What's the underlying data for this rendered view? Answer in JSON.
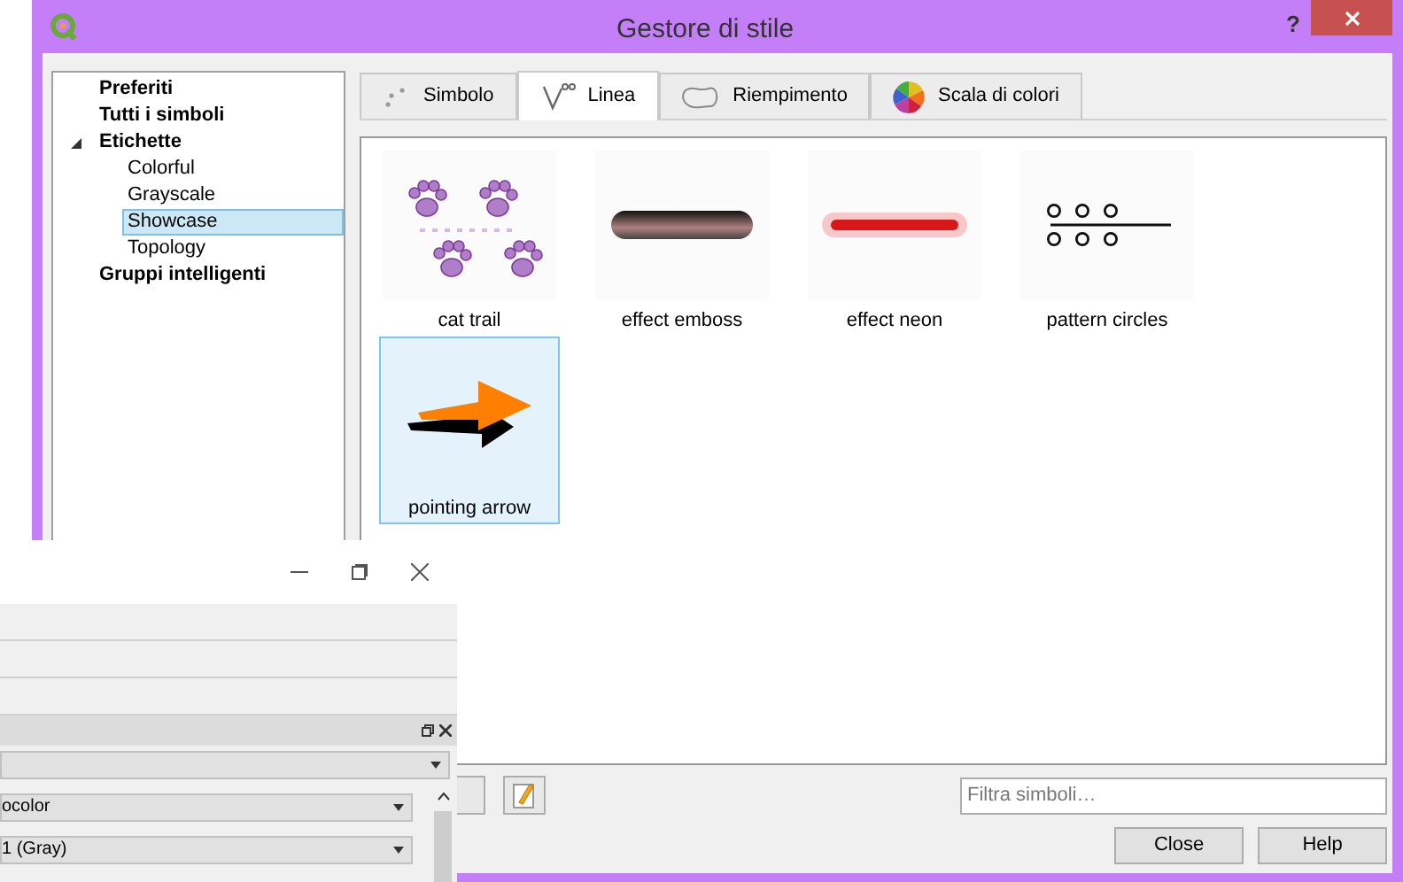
{
  "window": {
    "title": "Gestore di stile",
    "help": "?"
  },
  "tree": [
    {
      "label": "Preferiti",
      "selected": false
    },
    {
      "label": "Tutti i simboli",
      "selected": false
    },
    {
      "label": "Etichette",
      "selected": false,
      "expanded": true,
      "children": [
        {
          "label": "Colorful",
          "selected": false
        },
        {
          "label": "Grayscale",
          "selected": false
        },
        {
          "label": "Showcase",
          "selected": true
        },
        {
          "label": "Topology",
          "selected": false
        }
      ]
    },
    {
      "label": "Gruppi intelligenti",
      "selected": false
    }
  ],
  "tabs": [
    {
      "label": "Simbolo",
      "kind": "points",
      "selected": false
    },
    {
      "label": "Linea",
      "kind": "line",
      "selected": true
    },
    {
      "label": "Riempimento",
      "kind": "fill",
      "selected": false
    },
    {
      "label": "Scala di colori",
      "kind": "ramp",
      "selected": false
    }
  ],
  "symbols": [
    {
      "label": "cat trail",
      "kind": "paws",
      "selected": false
    },
    {
      "label": "effect emboss",
      "kind": "emboss",
      "selected": false
    },
    {
      "label": "effect neon",
      "kind": "neon",
      "selected": false
    },
    {
      "label": "pattern circles",
      "kind": "circles",
      "selected": false
    },
    {
      "label": "pointing arrow",
      "kind": "arrow",
      "selected": true
    }
  ],
  "filter": {
    "placeholder": "Filtra simboli…"
  },
  "buttons": [
    "Close",
    "Help"
  ],
  "overlapping_window": {
    "combos": [
      "ocolor",
      "1 (Gray)"
    ]
  }
}
